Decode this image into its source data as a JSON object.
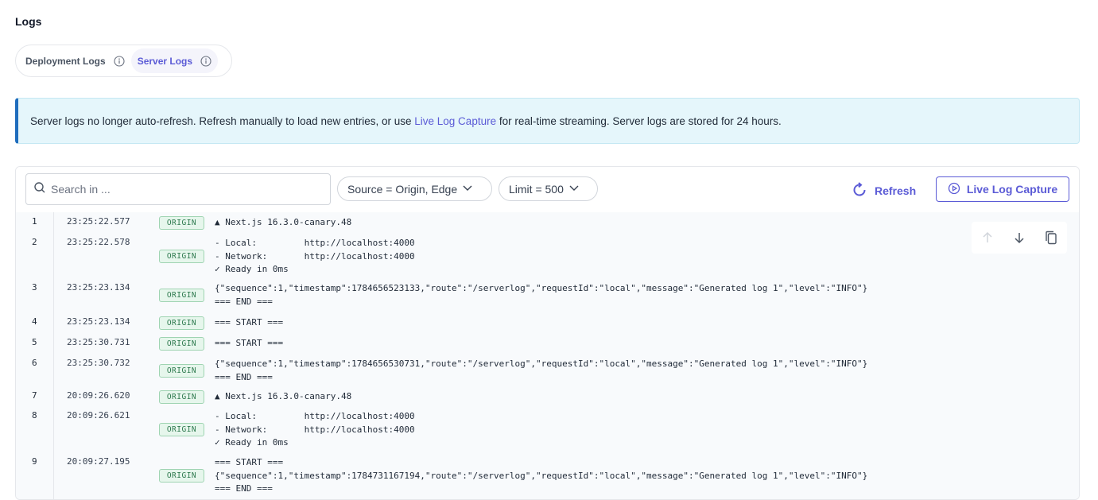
{
  "page": {
    "title": "Logs"
  },
  "tabs": [
    {
      "label": "Deployment Logs",
      "icon": "info-icon",
      "active": false
    },
    {
      "label": "Server Logs",
      "icon": "info-icon",
      "active": true
    }
  ],
  "banner": {
    "text_before": "Server logs no longer auto-refresh. Refresh manually to load new entries, or use ",
    "link": "Live Log Capture",
    "text_after": " for real-time streaming. Server logs are stored for 24 hours."
  },
  "toolbar": {
    "search_placeholder": "Search in ...",
    "source_filter": "Source = Origin, Edge",
    "limit_filter": "Limit = 500",
    "refresh_label": "Refresh",
    "live_capture_label": "Live Log Capture"
  },
  "colors": {
    "accent": "#5b5bd6",
    "banner_bg": "#e5f6fb",
    "badge_bg": "#e6f6ec",
    "badge_text": "#2f7a4f"
  },
  "logs": [
    {
      "num": "1",
      "time": "23:25:22.577",
      "source": "ORIGIN",
      "message": "▲ Next.js 16.3.0-canary.48"
    },
    {
      "num": "2",
      "time": "23:25:22.578",
      "source": "ORIGIN",
      "message": "- Local:         http://localhost:4000\n- Network:       http://localhost:4000\n✓ Ready in 0ms"
    },
    {
      "num": "3",
      "time": "23:25:23.134",
      "source": "ORIGIN",
      "message": "{\"sequence\":1,\"timestamp\":1784656523133,\"route\":\"/serverlog\",\"requestId\":\"local\",\"message\":\"Generated log 1\",\"level\":\"INFO\"}\n=== END ==="
    },
    {
      "num": "4",
      "time": "23:25:23.134",
      "source": "ORIGIN",
      "message": "=== START ==="
    },
    {
      "num": "5",
      "time": "23:25:30.731",
      "source": "ORIGIN",
      "message": "=== START ==="
    },
    {
      "num": "6",
      "time": "23:25:30.732",
      "source": "ORIGIN",
      "message": "{\"sequence\":1,\"timestamp\":1784656530731,\"route\":\"/serverlog\",\"requestId\":\"local\",\"message\":\"Generated log 1\",\"level\":\"INFO\"}\n=== END ==="
    },
    {
      "num": "7",
      "time": "20:09:26.620",
      "source": "ORIGIN",
      "message": "▲ Next.js 16.3.0-canary.48"
    },
    {
      "num": "8",
      "time": "20:09:26.621",
      "source": "ORIGIN",
      "message": "- Local:         http://localhost:4000\n- Network:       http://localhost:4000\n✓ Ready in 0ms"
    },
    {
      "num": "9",
      "time": "20:09:27.195",
      "source": "ORIGIN",
      "message": "=== START ===\n{\"sequence\":1,\"timestamp\":1784731167194,\"route\":\"/serverlog\",\"requestId\":\"local\",\"message\":\"Generated log 1\",\"level\":\"INFO\"}\n=== END ==="
    }
  ],
  "scroll_controls": {
    "up_icon": "arrow-up-icon",
    "down_icon": "arrow-down-icon",
    "copy_icon": "copy-icon"
  }
}
